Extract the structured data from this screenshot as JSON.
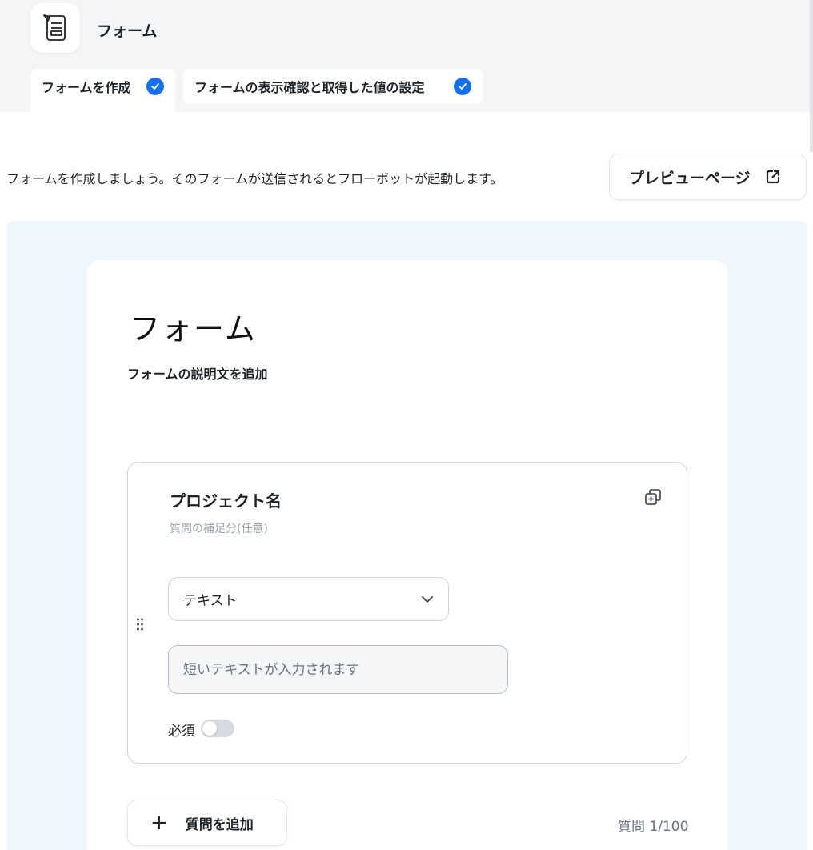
{
  "app": {
    "title": "フォーム",
    "icon": "form-icon"
  },
  "steps": [
    {
      "label": "フォームを作成",
      "status": "complete"
    },
    {
      "label": "フォームの表示確認と取得した値の設定",
      "status": "complete"
    }
  ],
  "intro": {
    "text": "フォームを作成しましょう。そのフォームが送信されるとフローボットが起動します。"
  },
  "preview": {
    "label": "プレビューページ",
    "icon": "external-link-icon"
  },
  "form": {
    "title": "フォーム",
    "description_placeholder": "フォームの説明文を追加"
  },
  "question": {
    "title": "プロジェクト名",
    "help_placeholder": "質問の補足分(任意)",
    "type_value": "テキスト",
    "answer_placeholder": "短いテキストが入力されます",
    "required_label": "必須",
    "required": false
  },
  "footer": {
    "add_question_label": "質問を追加",
    "count_text": "質問 1/100"
  },
  "colors": {
    "accent": "#1570ef",
    "canvas": "#eff6fe"
  }
}
